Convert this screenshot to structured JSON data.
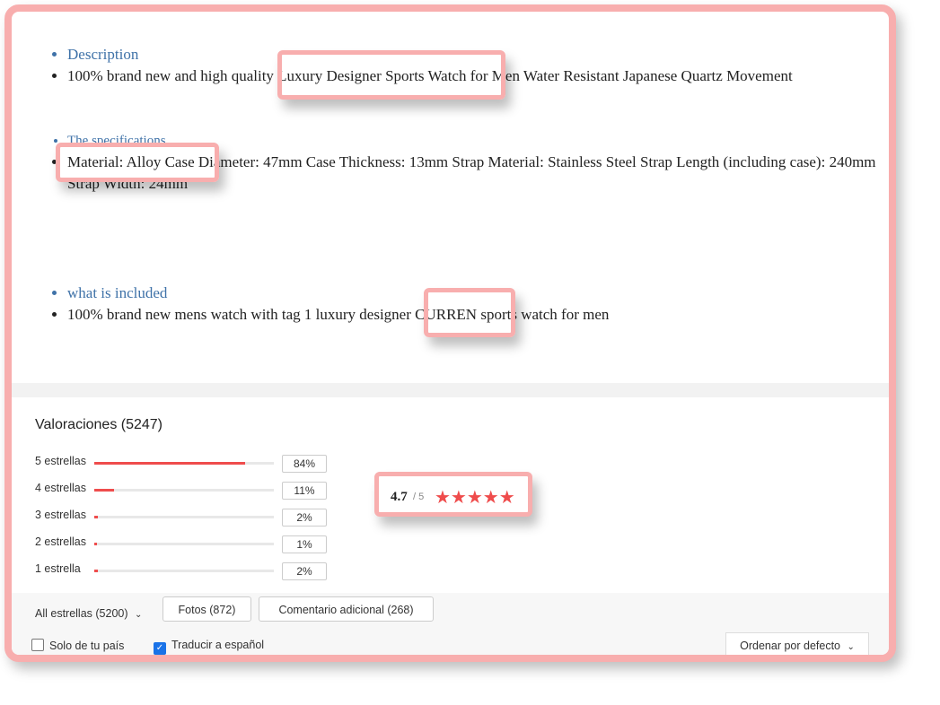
{
  "description": {
    "heading1": "Description",
    "item1": "100% brand new and high quality Luxury Designer Sports Watch for Men Water Resistant Japanese Quartz Movement",
    "heading2": "The specifications",
    "item2": "Material: Alloy Case Diameter: 47mm Case Thickness: 13mm Strap Material: Stainless Steel Strap Length (including case): 240mm Strap Width: 24mm",
    "heading3": "what is included",
    "item3": "100% brand new mens watch with tag 1 luxury designer CURREN sports watch for men"
  },
  "ratings": {
    "title": "Valoraciones (5247)",
    "rows": [
      {
        "label": "5 estrellas",
        "percent": "84%",
        "fraction": 0.84
      },
      {
        "label": "4 estrellas",
        "percent": "11%",
        "fraction": 0.11
      },
      {
        "label": "3 estrellas",
        "percent": "2%",
        "fraction": 0.02
      },
      {
        "label": "2 estrellas",
        "percent": "1%",
        "fraction": 0.01
      },
      {
        "label": "1 estrella",
        "percent": "2%",
        "fraction": 0.02
      }
    ],
    "average": "4.7",
    "max": "/ 5",
    "stars": "★★★★★",
    "star_color": "#ef4c4c"
  },
  "filters": {
    "all_stars": "All estrellas (5200)",
    "photos": "Fotos (872)",
    "additional": "Comentario adicional (268)",
    "only_country": "Solo de tu país",
    "translate": "Traducir a español",
    "sort": "Ordenar por defecto"
  },
  "colors": {
    "highlight": "#f8aeae",
    "accent": "#ef4c4c",
    "link": "#3f72a8"
  }
}
